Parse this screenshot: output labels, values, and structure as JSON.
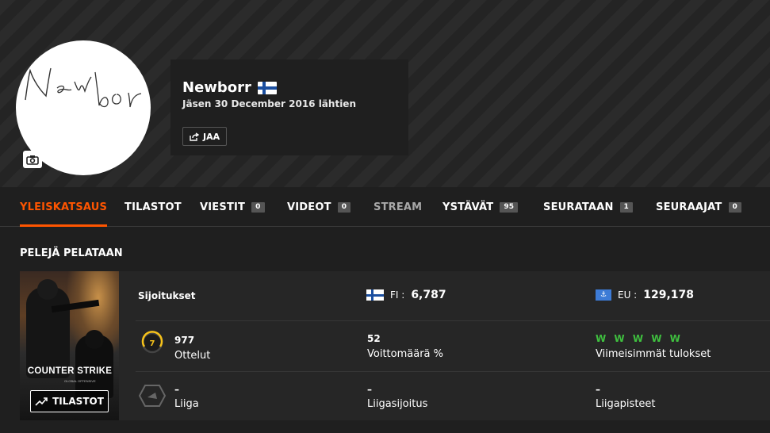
{
  "profile": {
    "avatar_signature": "Newbor",
    "nickname": "Newborr",
    "member_since": "Jäsen 30 December 2016 lähtien",
    "share_label": "JAA",
    "country_flag": "finland-flag-icon"
  },
  "nav": {
    "tabs": [
      {
        "label": "YLEISKATSAUS",
        "count": null,
        "active": true
      },
      {
        "label": "TILASTOT",
        "count": null
      },
      {
        "label": "VIESTIT",
        "count": "0"
      },
      {
        "label": "VIDEOT",
        "count": "0"
      },
      {
        "label": "STREAM",
        "count": null,
        "dimmed": true
      },
      {
        "label": "YSTÄVÄT",
        "count": "95"
      },
      {
        "label": "SEURATAAN",
        "count": "1"
      },
      {
        "label": "SEURAAJAT",
        "count": "0"
      }
    ],
    "accent": "#ff5500"
  },
  "games": {
    "title": "PELEJÄ PELATAAN",
    "game_logo": "COUNTER STRIKE",
    "game_logo_sub": "GLOBAL OFFENSIVE",
    "stats_button": "TILASTOT",
    "rankings_label": "Sijoitukset",
    "fi_rank": {
      "label": "FI :",
      "value": "6,787"
    },
    "eu_rank": {
      "label": "EU :",
      "value": "129,178"
    },
    "level": "7",
    "matches": {
      "value": "977",
      "label": "Ottelut"
    },
    "win_rate": {
      "value": "52",
      "label": "Voittomäärä %"
    },
    "recent": {
      "value": "W W W W W",
      "label": "Viimeisimmät tulokset",
      "color": "#3fbf3f"
    },
    "league": {
      "value": "–",
      "label": "Liiga"
    },
    "league_rank": {
      "value": "–",
      "label": "Liigasijoitus"
    },
    "league_points": {
      "value": "–",
      "label": "Liigapisteet"
    }
  }
}
